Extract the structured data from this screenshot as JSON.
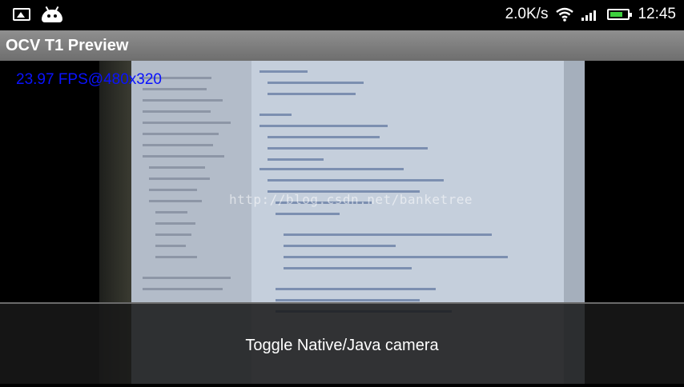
{
  "status_bar": {
    "network_speed": "2.0K/s",
    "time": "12:45",
    "left_icons": [
      "gallery-icon",
      "android-icon"
    ],
    "right_icons": [
      "wifi-icon",
      "signal-icon",
      "battery-icon"
    ],
    "battery_fill_color": "#3ecf3e"
  },
  "app": {
    "title": "OCV T1 Preview"
  },
  "preview": {
    "fps_text": "23.97 FPS@480x320",
    "fps_color": "#0a12ff",
    "watermark": "http://blog.csdn.net/banketree"
  },
  "action_bar": {
    "toggle_label": "Toggle Native/Java camera"
  }
}
